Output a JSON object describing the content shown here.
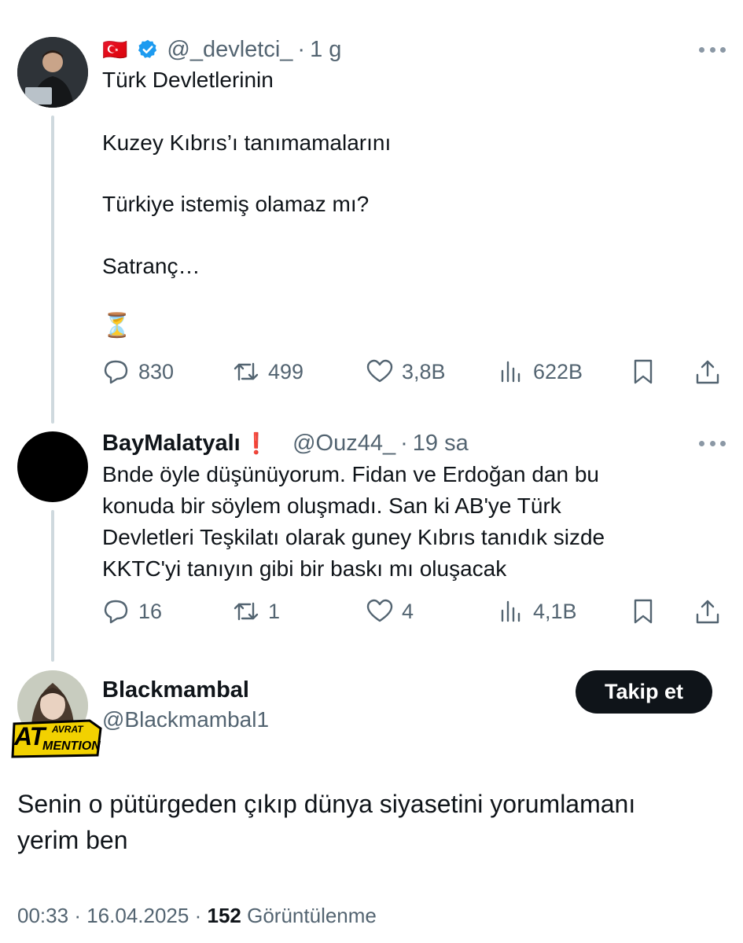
{
  "tweets": [
    {
      "flag": "🇹🇷",
      "verified": true,
      "handle": "@_devletci_",
      "separator": "·",
      "time": "1 g",
      "paragraphs": [
        "Türk Devletlerinin",
        "Kuzey Kıbrıs’ı tanımamalarını",
        "Türkiye istemiş olamaz mı?",
        "Satranç…",
        "⏳"
      ],
      "stats": {
        "replies": "830",
        "reposts": "499",
        "likes": "3,8B",
        "views": "622B"
      }
    },
    {
      "name": "BayMalatyalı",
      "badge": "❗",
      "handle": "@Ouz44_",
      "separator": "·",
      "time": "19 sa",
      "text": "Bnde öyle düşünüyorum. Fidan ve Erdoğan dan bu\nkonuda bir söylem oluşmadı. San ki AB'ye Türk\nDevletleri Teşkilatı olarak guney Kıbrıs tanıdık sizde\nKKTC'yi tanıyın gibi bir baskı mı oluşacak",
      "stats": {
        "replies": "16",
        "reposts": "1",
        "likes": "4",
        "views": "4,1B"
      }
    }
  ],
  "main_tweet": {
    "name": "Blackmambal",
    "handle": "@Blackmambal1",
    "badge_line1": "AT",
    "badge_line2": "AVRAT",
    "badge_line3": "MENTION",
    "follow_label": "Takip et",
    "text": "Senin o pütürgeden çıkıp dünya siyasetini yorumlamanı\nyerim ben",
    "time": "00:33",
    "date": "16.04.2025",
    "views_count": "152",
    "views_label": "Görüntülenme",
    "sep": "·"
  },
  "colors": {
    "text": "#0f1419",
    "muted": "#536471",
    "verified": "#1d9bf0",
    "thread_line": "#cfd9de"
  }
}
